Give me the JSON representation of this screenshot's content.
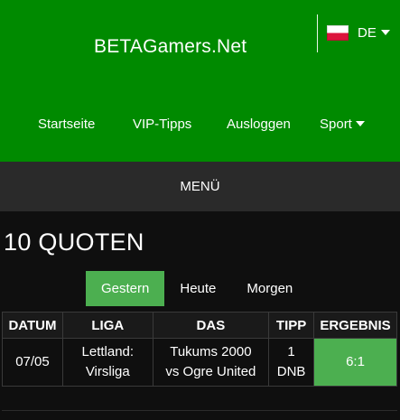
{
  "header": {
    "site_title": "BETAGamers.Net",
    "language": {
      "label": "DE",
      "flag_icon": "german-flag-icon"
    },
    "bg_color": "#008a00"
  },
  "nav": {
    "items": [
      {
        "label": "Startseite"
      },
      {
        "label": "VIP-Tipps"
      },
      {
        "label": "Ausloggen"
      },
      {
        "label": "Sport",
        "has_dropdown": true
      }
    ]
  },
  "menu": {
    "label": "MENÜ"
  },
  "page": {
    "title": "10 QUOTEN"
  },
  "tabs": [
    {
      "label": "Gestern",
      "active": true
    },
    {
      "label": "Heute",
      "active": false
    },
    {
      "label": "Morgen",
      "active": false
    }
  ],
  "table": {
    "headers": [
      "DATUM",
      "LIGA",
      "DAS",
      "TIPP",
      "ERGEBNIS"
    ],
    "rows": [
      {
        "date": "07/05",
        "league_line1": "Lettland:",
        "league_line2": "Virsliga",
        "match_line1": "Tukums 2000",
        "match_line2": "vs Ogre United",
        "tip_line1": "1",
        "tip_line2": "DNB",
        "result": "6:1"
      }
    ]
  },
  "colors": {
    "accent": "#4caf50",
    "header_green": "#008a00",
    "menu_bar": "#2a2a2a",
    "background": "#0f0f0f"
  }
}
